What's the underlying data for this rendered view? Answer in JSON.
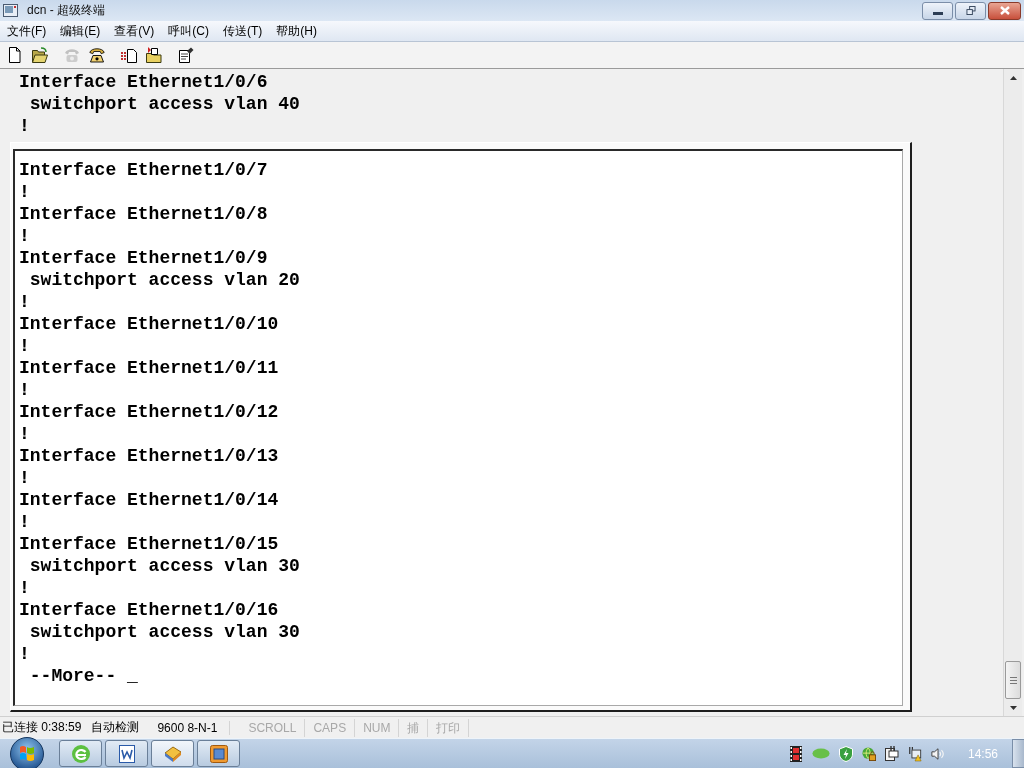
{
  "window": {
    "title": "dcn - 超级终端"
  },
  "menu": [
    "文件(F)",
    "编辑(E)",
    "查看(V)",
    "呼叫(C)",
    "传送(T)",
    "帮助(H)"
  ],
  "toolbar": [
    [
      {
        "kind": "new",
        "disabled": false
      },
      {
        "kind": "open",
        "disabled": false
      }
    ],
    [
      {
        "kind": "call",
        "disabled": true
      },
      {
        "kind": "disconnect",
        "disabled": false
      }
    ],
    [
      {
        "kind": "send",
        "disabled": false
      },
      {
        "kind": "receive",
        "disabled": false
      }
    ],
    [
      {
        "kind": "properties",
        "disabled": false
      }
    ]
  ],
  "terminal": {
    "lines": [
      "Interface Ethernet1/0/6",
      " switchport access vlan 40",
      "!"
    ],
    "panel_lines": [
      "Interface Ethernet1/0/7",
      "!",
      "Interface Ethernet1/0/8",
      "!",
      "Interface Ethernet1/0/9",
      " switchport access vlan 20",
      "!",
      "Interface Ethernet1/0/10",
      "!",
      "Interface Ethernet1/0/11",
      "!",
      "Interface Ethernet1/0/12",
      "!",
      "Interface Ethernet1/0/13",
      "!",
      "Interface Ethernet1/0/14",
      "!",
      "Interface Ethernet1/0/15",
      " switchport access vlan 30",
      "!",
      "Interface Ethernet1/0/16",
      " switchport access vlan 30",
      "!",
      " --More-- _"
    ]
  },
  "status_bar": {
    "fields": [
      "已连接 0:38:59",
      "自动检测",
      "9600 8-N-1"
    ],
    "indicators": [
      {
        "label": "SCROLL",
        "on": false
      },
      {
        "label": "CAPS",
        "on": false
      },
      {
        "label": "NUM",
        "on": false
      },
      {
        "label": "捕",
        "on": false
      },
      {
        "label": "打印",
        "on": false
      }
    ]
  },
  "taskbar": {
    "clock": "14:56"
  }
}
